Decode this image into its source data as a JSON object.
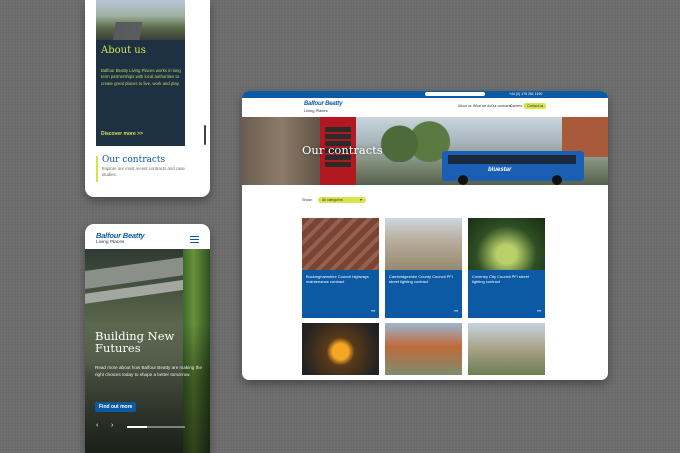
{
  "phone_about": {
    "heading": "About us",
    "body": "Balfour Beatty Living Places works in long term partnerships with local authorities to create great places to live, work and play.",
    "link": "Discover more >>",
    "contracts_heading": "Our contracts",
    "contracts_body": "Explore our most recent contracts and case studies."
  },
  "phone_home": {
    "logo_main": "Balfour Beatty",
    "logo_sub": "Living Places",
    "hero_title": "Building New Futures",
    "hero_body": "Read more about how Balfour Beatty are making the right choices today to shape a better tomorrow.",
    "cta": "Find out more",
    "prev": "‹",
    "next": "›"
  },
  "desktop": {
    "phone": "+44 (0) 175 251 1190",
    "logo_main": "Balfour Beatty",
    "logo_sub": "Living Places",
    "nav": [
      "About us",
      "What we do",
      "Our contracts",
      "Careers"
    ],
    "contact": "Contact us",
    "hero_title": "Our contracts",
    "bus_text": "bluestar",
    "filter_label": "Show:",
    "filter_value": "All categories",
    "contracts": [
      {
        "title": "Buckinghamshire Council highways maintenance contract"
      },
      {
        "title": "Cambridgeshire County Council PFI street lighting contract"
      },
      {
        "title": "Coventry City Council PFI street lighting contract"
      },
      {
        "title": ""
      },
      {
        "title": ""
      },
      {
        "title": ""
      }
    ],
    "arrow": "›››››"
  },
  "colors": {
    "brand_blue": "#0b5aa3",
    "accent_yellow": "#d7e34b",
    "navy": "#1e3143"
  }
}
